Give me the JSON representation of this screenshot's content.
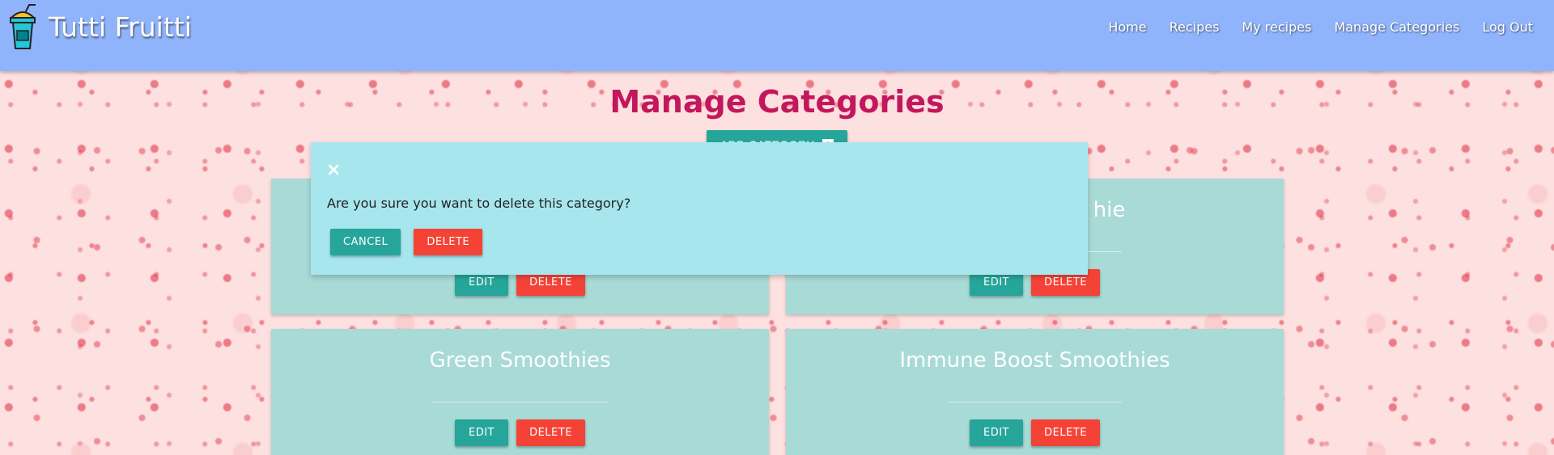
{
  "header": {
    "brand": "Tutti Fruitti",
    "logo_icon": "smoothie-cup-icon",
    "nav": [
      "Home",
      "Recipes",
      "My recipes",
      "Manage Categories",
      "Log Out"
    ]
  },
  "main": {
    "title": "Manage Categories",
    "add_button_label": "ADD CATEGORY",
    "add_button_icon": "plus-box-icon",
    "cards": [
      {
        "title": "",
        "edit_label": "EDIT",
        "delete_label": "DELETE"
      },
      {
        "title": "hie",
        "edit_label": "EDIT",
        "delete_label": "DELETE"
      },
      {
        "title": "Green Smoothies",
        "edit_label": "EDIT",
        "delete_label": "DELETE"
      },
      {
        "title": "Immune Boost Smoothies",
        "edit_label": "EDIT",
        "delete_label": "DELETE"
      }
    ]
  },
  "modal": {
    "close_label": "×",
    "message": "Are you sure you want to delete this category?",
    "cancel_label": "CANCEL",
    "delete_label": "DELETE"
  },
  "colors": {
    "navbar": "#90b4fb",
    "title": "#c2185b",
    "teal": "#26a69a",
    "red": "#f44336",
    "card": "#a8dad6",
    "modal": "#a8e6ee"
  }
}
